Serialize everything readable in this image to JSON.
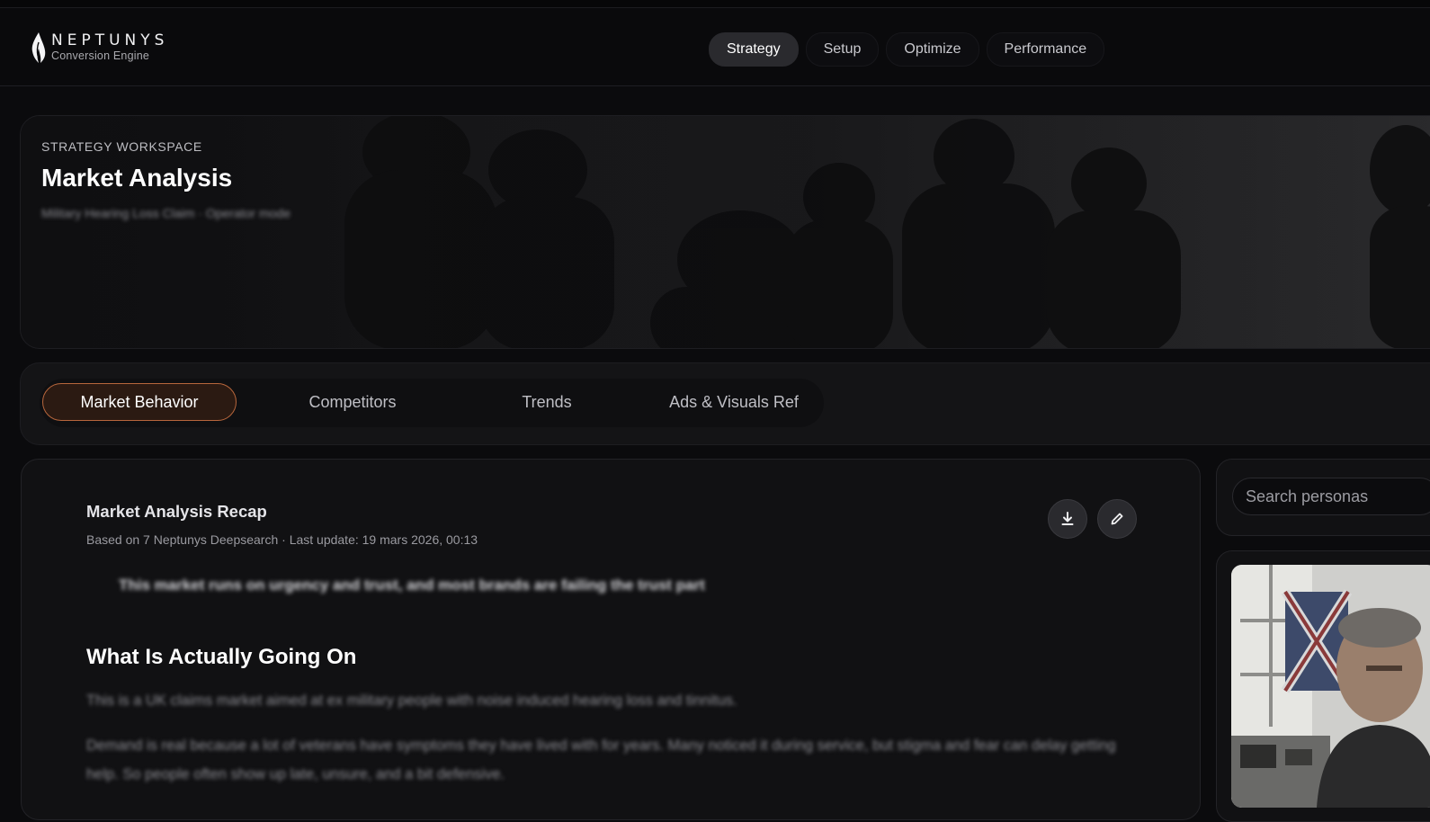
{
  "brand": {
    "name": "NEPTUNYS",
    "tagline": "Conversion Engine",
    "logo_icon": "flame-logo-icon"
  },
  "nav": {
    "items": [
      {
        "label": "Strategy",
        "active": true
      },
      {
        "label": "Setup",
        "active": false
      },
      {
        "label": "Optimize",
        "active": false
      },
      {
        "label": "Performance",
        "active": false
      }
    ]
  },
  "hero": {
    "eyebrow": "STRATEGY WORKSPACE",
    "title": "Market Analysis",
    "subtitle": "Military Hearing Loss Claim · Operator mode"
  },
  "tabs": {
    "items": [
      {
        "label": "Market Behavior",
        "active": true
      },
      {
        "label": "Competitors",
        "active": false
      },
      {
        "label": "Trends",
        "active": false
      },
      {
        "label": "Ads & Visuals Ref",
        "active": false
      }
    ]
  },
  "recap": {
    "title": "Market Analysis Recap",
    "meta": "Based on 7 Neptunys Deepsearch · Last update: 19 mars 2026, 00:13",
    "actions": {
      "download_icon": "download-icon",
      "edit_icon": "pencil-icon"
    },
    "quote": "This market runs on urgency and trust, and most brands are failing the trust part",
    "section_heading": "What Is Actually Going On",
    "paragraph_1": "This is a UK claims market aimed at ex military people with noise induced hearing loss and tinnitus.",
    "paragraph_2": "Demand is real because a lot of veterans have symptoms they have lived with for years. Many noticed it during service, but stigma and fear can delay getting help. So people often show up late, unsure, and a bit defensive."
  },
  "personas": {
    "search_placeholder": "Search personas"
  },
  "colors": {
    "accent": "#b7663c",
    "accent_bg": "#2b1a12",
    "background": "#0b0b0d",
    "card": "#111113"
  }
}
